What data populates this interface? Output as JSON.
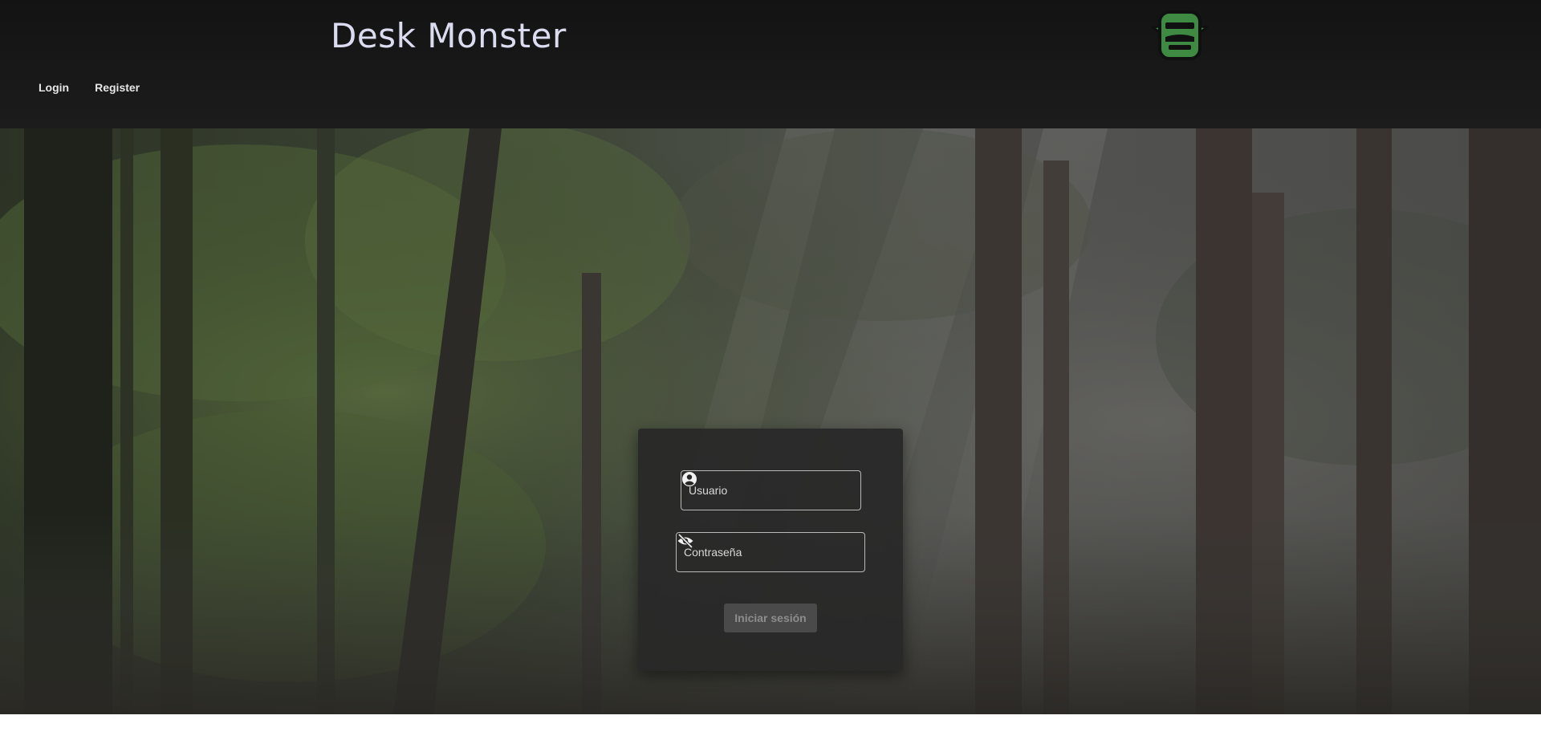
{
  "header": {
    "brand": "Desk Monster",
    "logo_icon": "monster-face-icon",
    "nav": [
      {
        "label": "Login"
      },
      {
        "label": "Register"
      }
    ]
  },
  "login_form": {
    "username": {
      "placeholder": "Usuario",
      "icon": "user-circle-icon"
    },
    "password": {
      "placeholder": "Contraseña",
      "icon": "eye-slash-icon"
    },
    "submit_label": "Iniciar sesión"
  },
  "colors": {
    "header_bg": "#181818",
    "brand_text": "#dcdcf0",
    "card_bg": "#282828",
    "logo_green": "#3f8a43"
  }
}
